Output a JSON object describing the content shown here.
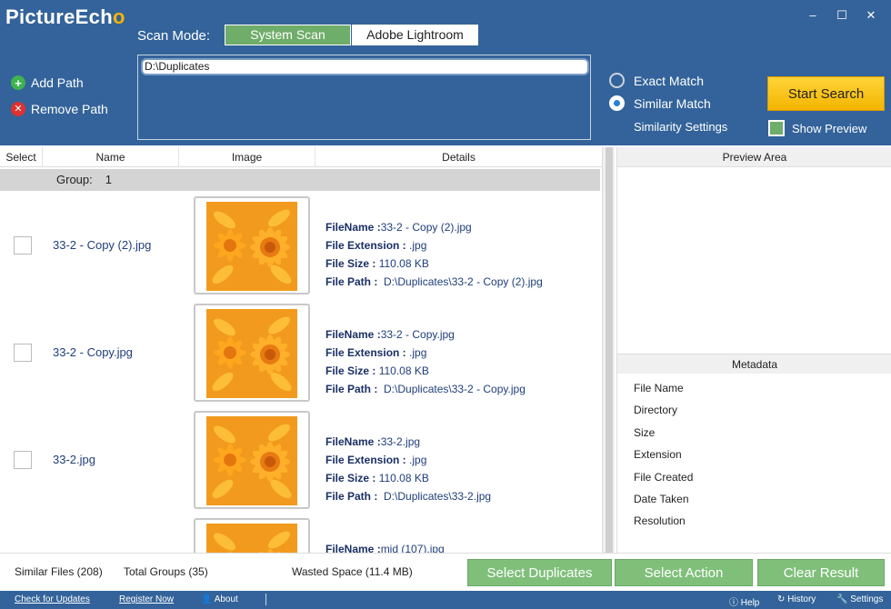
{
  "app": {
    "logo_main": "PictureEch",
    "logo_tail": "o",
    "window_controls": [
      "–",
      "☐",
      "✕"
    ]
  },
  "scan": {
    "label": "Scan Mode:",
    "modes": [
      "System Scan",
      "Adobe Lightroom"
    ]
  },
  "paths": {
    "items": [
      "D:\\Duplicates"
    ],
    "add_label": "Add Path",
    "remove_label": "Remove Path"
  },
  "match": {
    "exact_label": "Exact Match",
    "similar_label": "Similar Match",
    "selected": "Similar Match",
    "settings_label": "Similarity Settings"
  },
  "start_search_label": "Start Search",
  "show_preview_label": "Show Preview",
  "columns": [
    "Select",
    "Name",
    "Image",
    "Details"
  ],
  "group": {
    "label": "Group:",
    "number": "1"
  },
  "rows": [
    {
      "name": "33-2 - Copy (2).jpg",
      "file_name_label": "FileName :",
      "file_name": "33-2 - Copy (2).jpg",
      "ext_label": "File Extension :",
      "ext": ".jpg",
      "size_label": "File Size :",
      "size": "110.08 KB",
      "path_label": "File Path :",
      "path": "D:\\Duplicates\\33-2 - Copy (2).jpg"
    },
    {
      "name": "33-2 - Copy.jpg",
      "file_name_label": "FileName :",
      "file_name": "33-2 - Copy.jpg",
      "ext_label": "File Extension :",
      "ext": ".jpg",
      "size_label": "File Size :",
      "size": "110.08 KB",
      "path_label": "File Path :",
      "path": "D:\\Duplicates\\33-2 - Copy.jpg"
    },
    {
      "name": "33-2.jpg",
      "file_name_label": "FileName :",
      "file_name": "33-2.jpg",
      "ext_label": "File Extension :",
      "ext": ".jpg",
      "size_label": "File Size :",
      "size": "110.08 KB",
      "path_label": "File Path :",
      "path": "D:\\Duplicates\\33-2.jpg"
    },
    {
      "name": "",
      "file_name_label": "FileName :",
      "file_name": "mid (107).jpg",
      "ext_label": "",
      "ext": "",
      "size_label": "",
      "size": "",
      "path_label": "",
      "path": ""
    }
  ],
  "preview_area_label": "Preview Area",
  "metadata": {
    "title": "Metadata",
    "fields": [
      "File Name",
      "Directory",
      "Size",
      "Extension",
      "File Created",
      "Date Taken",
      "Resolution"
    ]
  },
  "status": {
    "similar_files": "Similar Files (208)",
    "total_groups": "Total Groups (35)",
    "wasted_space": "Wasted Space (11.4 MB)"
  },
  "actions": {
    "select_duplicates": "Select Duplicates",
    "select_action": "Select Action",
    "clear_result": "Clear Result"
  },
  "footer": {
    "check_updates": "Check for Updates",
    "register_now": "Register Now",
    "about": "About",
    "help": "Help",
    "history": "History",
    "settings": "Settings"
  },
  "colors": {
    "header_bg": "#33639a",
    "accent_green": "#6fad6a",
    "start_yellow": "#f3b500"
  }
}
